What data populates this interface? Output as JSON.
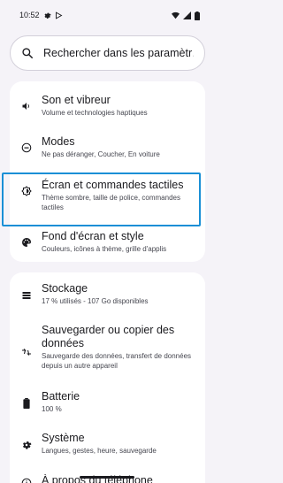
{
  "status_bar": {
    "time": "10:52",
    "left_icons": [
      "gear-icon",
      "play-store-icon"
    ],
    "right_icons": [
      "wifi-icon",
      "cellular-icon",
      "battery-icon"
    ]
  },
  "search": {
    "placeholder": "Rechercher dans les paramètr…"
  },
  "groups": [
    {
      "items": [
        {
          "icon": "volume-icon",
          "title": "Son et vibreur",
          "subtitle": "Volume et technologies haptiques"
        },
        {
          "icon": "do-not-disturb-icon",
          "title": "Modes",
          "subtitle": "Ne pas déranger, Coucher, En voiture"
        },
        {
          "icon": "brightness-icon",
          "title": "Écran et commandes tactiles",
          "subtitle": "Thème sombre, taille de police, commandes tactiles"
        },
        {
          "icon": "palette-icon",
          "title": "Fond d'écran et style",
          "subtitle": "Couleurs, icônes à thème, grille d'applis"
        }
      ]
    },
    {
      "items": [
        {
          "icon": "storage-icon",
          "title": "Stockage",
          "subtitle": "17 % utilisés - 107 Go disponibles"
        },
        {
          "icon": "backup-icon",
          "title": "Sauvegarder ou copier des données",
          "subtitle": "Sauvegarde des données, transfert de données depuis un autre appareil"
        },
        {
          "icon": "battery-icon",
          "title": "Batterie",
          "subtitle": "100 %"
        },
        {
          "icon": "system-gear-icon",
          "title": "Système",
          "subtitle": "Langues, gestes, heure, sauvegarde"
        },
        {
          "icon": "info-icon",
          "title": "À propos du téléphone",
          "subtitle": ""
        }
      ]
    }
  ],
  "highlight_color": "#1a8fd6"
}
